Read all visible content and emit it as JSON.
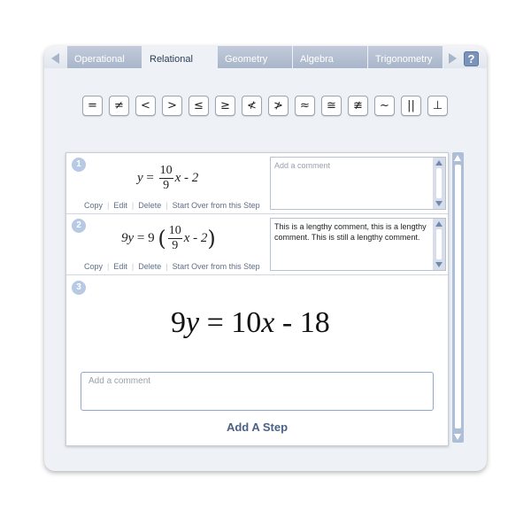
{
  "tabs": [
    "Operational",
    "Relational",
    "Geometry",
    "Algebra",
    "Trigonometry"
  ],
  "active_tab": "Relational",
  "help_label": "?",
  "symbols": [
    "=",
    "≠",
    "<",
    ">",
    "≤",
    "≥",
    "≮",
    "≯",
    "≈",
    "≅",
    "≇",
    "~",
    "||",
    "⊥"
  ],
  "actions": [
    "Copy",
    "Edit",
    "Delete",
    "Start Over from this Step"
  ],
  "steps": [
    {
      "number": "1",
      "comment_placeholder": "Add a comment",
      "comment": ""
    },
    {
      "number": "2",
      "comment_placeholder": "Add a comment",
      "comment": "This is a lengthy comment, this is a lengthy comment. This is still a lengthy comment."
    },
    {
      "number": "3"
    }
  ],
  "equations": {
    "step1": {
      "lhs": "y",
      "eq": "=",
      "num": "10",
      "den": "9",
      "rest": "x - 2"
    },
    "step2": {
      "lhs": "9y",
      "eq": "= 9",
      "num": "10",
      "den": "9",
      "rest": "x - 2"
    },
    "step3": {
      "coef": "9",
      "var": "y",
      "eq": "=",
      "rcoef": "10",
      "rvar": "x",
      "tail": "- 18"
    }
  },
  "main_comment_placeholder": "Add a comment",
  "add_step_label": "Add A Step",
  "colors": {
    "accent": "#4a6286",
    "tab": "#a9b5c9",
    "scroll": "#aebed7"
  }
}
